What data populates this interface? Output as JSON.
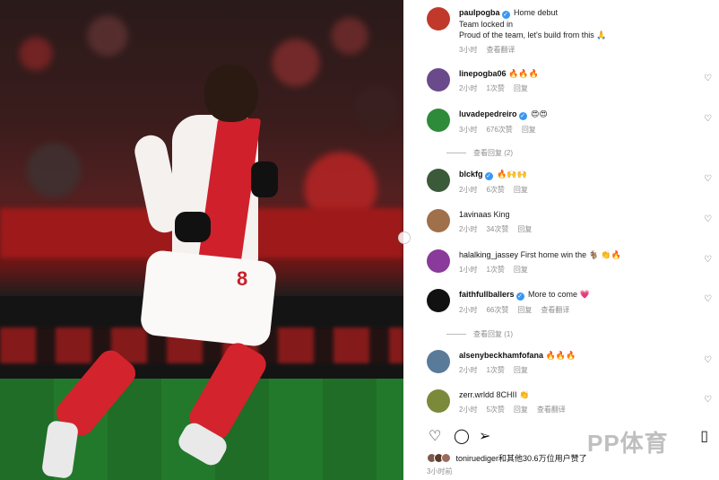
{
  "post": {
    "author": "paulpogba",
    "caption_lines": [
      "Home debut",
      "Team locked in",
      "Proud of the team, let's build from this 🙏"
    ],
    "time": "3小时",
    "translate": "查看翻译"
  },
  "comments": [
    {
      "user": "linepogba06",
      "verified": false,
      "text": "🔥🔥🔥",
      "time": "2小时",
      "likes": "1次赞",
      "reply": "回复",
      "translate": "",
      "avatar_color": "#6a4a8a"
    },
    {
      "user": "luvadepedreiro",
      "verified": true,
      "text": "😍😍",
      "time": "3小时",
      "likes": "676次赞",
      "reply": "回复",
      "translate": "",
      "avatar_color": "#2e8b3a",
      "view_replies": "查看回复 (2)"
    },
    {
      "user": "blckfg",
      "verified": true,
      "text": "🔥🙌🙌",
      "time": "2小时",
      "likes": "6次赞",
      "reply": "回复",
      "translate": "",
      "avatar_color": "#3a5a3a"
    },
    {
      "user": "1avinaas",
      "verified": false,
      "text": "King",
      "time": "2小时",
      "likes": "34次赞",
      "reply": "回复",
      "translate": "",
      "avatar_color": "#a0704a"
    },
    {
      "user": "halalking_jassey",
      "verified": false,
      "text": "First home win the 🐐 👏🔥",
      "time": "1小时",
      "likes": "1次赞",
      "reply": "回复",
      "translate": "",
      "avatar_color": "#8a3a9a"
    },
    {
      "user": "faithfullballers",
      "verified": true,
      "text": "More to come 💗",
      "time": "2小时",
      "likes": "66次赞",
      "reply": "回复",
      "translate": "查看翻译",
      "avatar_color": "#111111",
      "view_replies": "查看回复 (1)"
    },
    {
      "user": "alsenybeckhamfofana",
      "verified": false,
      "text": "🔥🔥🔥",
      "time": "2小时",
      "likes": "1次赞",
      "reply": "回复",
      "translate": "",
      "avatar_color": "#5a7a9a"
    },
    {
      "user": "zerr.wrldd",
      "verified": false,
      "text": "8CHII 👏",
      "time": "2小时",
      "likes": "5次赞",
      "reply": "回复",
      "translate": "查看翻译",
      "avatar_color": "#7a8a3a"
    }
  ],
  "likes_text": "toniruediger和其他30.6万位用户赞了",
  "post_time": "3小时前",
  "watermark": "PP体育",
  "icons": {
    "heart": "heart-icon",
    "comment": "comment-icon",
    "share": "share-icon",
    "bookmark": "bookmark-icon"
  }
}
